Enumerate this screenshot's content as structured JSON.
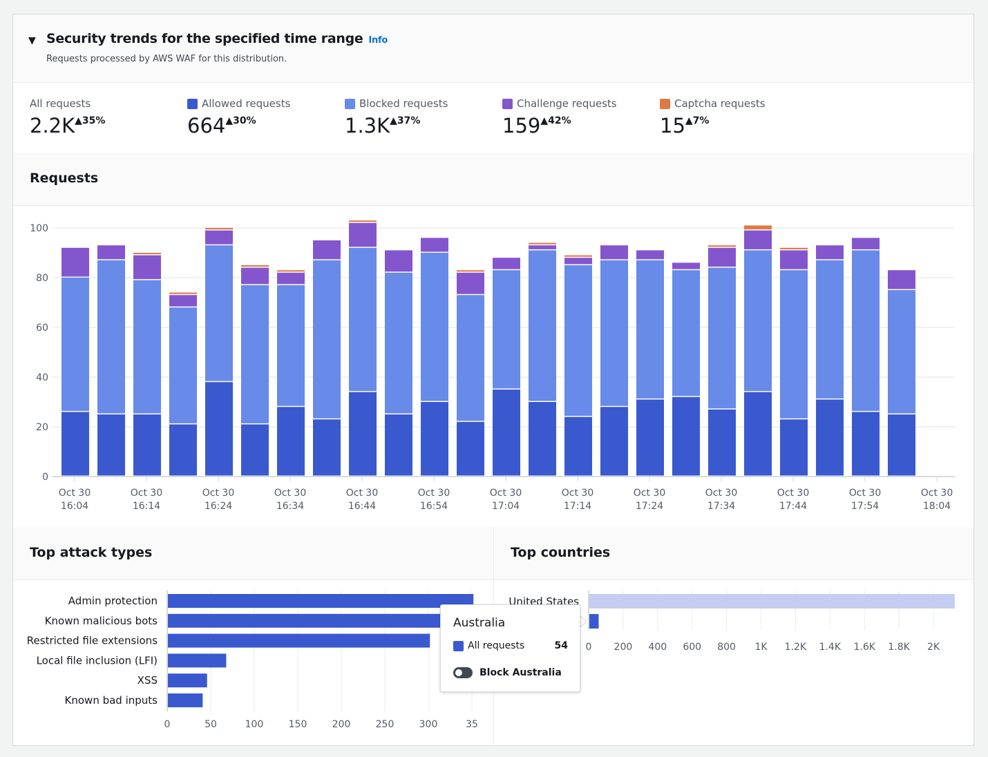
{
  "header": {
    "title": "Security trends for the specified time range",
    "info_link": "Info",
    "subtitle": "Requests processed by AWS WAF for this distribution."
  },
  "metrics": [
    {
      "label": "All requests",
      "value": "2.2K",
      "delta": "35%",
      "color": ""
    },
    {
      "label": "Allowed requests",
      "value": "664",
      "delta": "30%",
      "color": "#3a59cf"
    },
    {
      "label": "Blocked requests",
      "value": "1.3K",
      "delta": "37%",
      "color": "#688ae8"
    },
    {
      "label": "Challenge requests",
      "value": "159",
      "delta": "42%",
      "color": "#8456ce"
    },
    {
      "label": "Captcha requests",
      "value": "15",
      "delta": "7%",
      "color": "#e07941"
    }
  ],
  "sections": {
    "requests": "Requests",
    "attack_types": "Top attack types",
    "countries": "Top countries"
  },
  "chart_data": [
    {
      "type": "bar",
      "stacked": true,
      "grid": true,
      "ylim": [
        0,
        100
      ],
      "yticks": [
        "0",
        "20",
        "40",
        "60",
        "80",
        "100"
      ],
      "xticks": [
        [
          "Oct 30",
          "16:04"
        ],
        [
          "Oct 30",
          "16:14"
        ],
        [
          "Oct 30",
          "16:24"
        ],
        [
          "Oct 30",
          "16:34"
        ],
        [
          "Oct 30",
          "16:44"
        ],
        [
          "Oct 30",
          "16:54"
        ],
        [
          "Oct 30",
          "17:04"
        ],
        [
          "Oct 30",
          "17:14"
        ],
        [
          "Oct 30",
          "17:24"
        ],
        [
          "Oct 30",
          "17:34"
        ],
        [
          "Oct 30",
          "17:44"
        ],
        [
          "Oct 30",
          "17:54"
        ],
        [
          "Oct 30",
          "18:04"
        ]
      ],
      "x": [
        "16:04",
        "16:09",
        "16:14",
        "16:19",
        "16:24",
        "16:29",
        "16:34",
        "16:39",
        "16:44",
        "16:49",
        "16:54",
        "16:59",
        "17:04",
        "17:09",
        "17:14",
        "17:19",
        "17:24",
        "17:29",
        "17:34",
        "17:39",
        "17:44",
        "17:49",
        "17:54",
        "17:59"
      ],
      "series": [
        {
          "name": "Allowed requests",
          "color": "#3a59cf",
          "values": [
            26,
            25,
            25,
            21,
            38,
            21,
            28,
            23,
            34,
            25,
            30,
            22,
            35,
            30,
            24,
            28,
            31,
            32,
            27,
            34,
            23,
            31,
            26,
            25
          ]
        },
        {
          "name": "Blocked requests",
          "color": "#688ae8",
          "values": [
            54,
            62,
            54,
            47,
            55,
            56,
            49,
            64,
            58,
            57,
            60,
            51,
            48,
            61,
            61,
            59,
            56,
            51,
            57,
            57,
            60,
            56,
            65,
            50
          ]
        },
        {
          "name": "Challenge requests",
          "color": "#8456ce",
          "values": [
            12,
            6,
            10,
            5,
            6,
            7,
            5,
            8,
            10,
            9,
            6,
            9,
            5,
            2,
            3,
            6,
            4,
            3,
            8,
            8,
            8,
            6,
            5,
            8
          ]
        },
        {
          "name": "Captcha requests",
          "color": "#e07941",
          "values": [
            0,
            0,
            1,
            1,
            1,
            1,
            1,
            0,
            1,
            0,
            0,
            1,
            0,
            1,
            1,
            0,
            0,
            0,
            1,
            2,
            1,
            0,
            0,
            0
          ]
        }
      ]
    },
    {
      "type": "bar",
      "orientation": "horizontal",
      "color": "#3a59cf",
      "categories": [
        "Admin protection",
        "Known malicious bots",
        "Restricted file extensions",
        "Local file inclusion (LFI)",
        "XSS",
        "Known bad inputs"
      ],
      "values": [
        351,
        350,
        301,
        67,
        45,
        40
      ],
      "xticks": [
        "0",
        "50",
        "100",
        "150",
        "200",
        "250",
        "300",
        "35"
      ],
      "xlim": [
        0,
        350
      ]
    },
    {
      "type": "bar",
      "orientation": "horizontal",
      "color": "#3a59cf",
      "faded_color": "#c5cdf2",
      "categories": [
        "United States",
        "Australia"
      ],
      "values": [
        2120,
        54
      ],
      "xticks": [
        "0",
        "200",
        "400",
        "600",
        "800",
        "1K",
        "1.2K",
        "1.4K",
        "1.6K",
        "1.8K",
        "2K"
      ],
      "xlim": [
        0,
        2120
      ]
    }
  ],
  "tooltip": {
    "title": "Australia",
    "series_label": "All requests",
    "value": "54",
    "toggle_label": "Block Australia",
    "toggle_on": false
  }
}
